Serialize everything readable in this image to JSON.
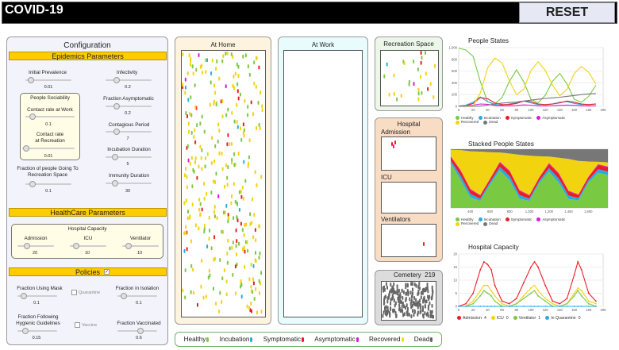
{
  "app": {
    "title": "COVID-19",
    "reset_label": "RESET"
  },
  "config": {
    "title": "Configuration",
    "epidemics": {
      "header": "Epidemics Parameters",
      "initial_prevalence": {
        "label": "Initial Prevalence",
        "value": "0.01",
        "fraction": 0.05
      },
      "infectivity": {
        "label": "Infectivity",
        "value": "0.2",
        "fraction": 0.2
      },
      "sociability_title": "People Sociability",
      "contact_work": {
        "label": "Contact rate at Work",
        "value": "0.1",
        "fraction": 0.1
      },
      "contact_recreation": {
        "label": "Contact rate\nat Recreation",
        "value": "0.01",
        "fraction": 0.02
      },
      "fraction_asymptomatic": {
        "label": "Fraction Asymptomatic",
        "value": "0.2",
        "fraction": 0.2
      },
      "contagious_period": {
        "label": "Contagious Period",
        "value": "7",
        "fraction": 0.2
      },
      "incubation_duration": {
        "label": "Incubation Duration",
        "value": "5",
        "fraction": 0.15
      },
      "fraction_recreation": {
        "label": "Fraction of people Going To\nRecreation Space",
        "value": "0.1",
        "fraction": 0.1
      },
      "immunity_duration": {
        "label": "Immunity Duration",
        "value": "30",
        "fraction": 0.15
      }
    },
    "healthcare": {
      "header": "HealthCare Parameters",
      "capacity_title": "Hospital Capacity",
      "admission": {
        "label": "Admission",
        "value": "20",
        "fraction": 0.2
      },
      "icu": {
        "label": "ICU",
        "value": "10",
        "fraction": 0.1
      },
      "ventilator": {
        "label": "Ventilator",
        "value": "10",
        "fraction": 0.1
      }
    },
    "policies": {
      "header": "Policies",
      "header_checked": true,
      "using_mask": {
        "label": "Fraction Using Mask",
        "value": "0.1",
        "fraction": 0.1
      },
      "quarantine_label": "Quarantine",
      "isolation": {
        "label": "Fraction in Isolation",
        "value": "0.1",
        "fraction": 0.1
      },
      "hygienic": {
        "label": "Fraction Following\nHygienic Guidelines",
        "value": "0.15",
        "fraction": 0.15
      },
      "vaccine_label": "Vaccine",
      "vaccinated": {
        "label": "Fraction Vaccinated",
        "value": "0.6",
        "fraction": 0.6
      }
    }
  },
  "spaces": {
    "home": "At Home",
    "work": "At Work",
    "recreation": "Recreation Space",
    "hospital": "Hospital",
    "admission": "Admission",
    "icu": "ICU",
    "ventilators": "Ventilators",
    "cemetery": "Cemetery",
    "cemetery_count": "219"
  },
  "legend": [
    {
      "label": "Healthy",
      "color": "#7ac943"
    },
    {
      "label": "Incubation",
      "color": "#29abe2"
    },
    {
      "label": "Symptomatic",
      "color": "#ed1c24"
    },
    {
      "label": "Asymptomatic",
      "color": "#d81bd8"
    },
    {
      "label": "Recovered",
      "color": "#f7e017"
    },
    {
      "label": "Dead",
      "color": "#666666"
    }
  ],
  "colors": {
    "healthy": "#7ac943",
    "incubation": "#29abe2",
    "symptomatic": "#ed1c24",
    "asymptomatic": "#d81bd8",
    "recovered": "#f2d30f",
    "dead": "#777777",
    "header_yellow": "#ffcc00"
  },
  "chart_data": [
    {
      "type": "line",
      "title": "People States",
      "xlim": [
        0,
        200
      ],
      "ylim": [
        0,
        1000
      ],
      "x_ticks": [
        "0",
        "20",
        "40",
        "60",
        "80",
        "100",
        "120",
        "140",
        "160",
        "180",
        "200"
      ],
      "y_ticks": [
        "0",
        "200",
        "400",
        "600",
        "800",
        "1,000"
      ],
      "x": [
        0,
        10,
        20,
        30,
        40,
        50,
        60,
        70,
        80,
        90,
        100,
        110,
        120,
        130,
        140,
        150,
        160,
        170,
        180,
        190
      ],
      "series": [
        {
          "name": "Healthy",
          "color": "#7ac943",
          "values": [
            990,
            960,
            850,
            420,
            80,
            40,
            150,
            420,
            620,
            420,
            120,
            60,
            190,
            430,
            560,
            380,
            120,
            70,
            170,
            360
          ]
        },
        {
          "name": "Incubation",
          "color": "#29abe2",
          "values": [
            5,
            20,
            70,
            160,
            80,
            30,
            20,
            40,
            60,
            90,
            60,
            30,
            30,
            40,
            70,
            80,
            50,
            30,
            30,
            40
          ]
        },
        {
          "name": "Symptomatic",
          "color": "#ed1c24",
          "values": [
            3,
            10,
            50,
            150,
            130,
            60,
            30,
            30,
            50,
            90,
            80,
            40,
            30,
            40,
            60,
            90,
            70,
            40,
            30,
            40
          ]
        },
        {
          "name": "Asymptomatic",
          "color": "#d81bd8",
          "values": [
            2,
            6,
            20,
            40,
            35,
            15,
            8,
            10,
            15,
            25,
            20,
            10,
            8,
            12,
            18,
            22,
            18,
            10,
            8,
            10
          ]
        },
        {
          "name": "Recovered",
          "color": "#f2d30f",
          "values": [
            0,
            4,
            10,
            230,
            650,
            820,
            740,
            440,
            200,
            290,
            610,
            760,
            610,
            360,
            180,
            290,
            560,
            680,
            580,
            380
          ]
        },
        {
          "name": "Dead",
          "color": "#777777",
          "values": [
            0,
            0,
            0,
            5,
            20,
            40,
            55,
            65,
            75,
            90,
            105,
            120,
            135,
            145,
            155,
            170,
            185,
            200,
            212,
            219
          ]
        }
      ],
      "legend": [
        "Healthy",
        "Incubation",
        "Symptomatic",
        "Asymptomatic",
        "Recovered",
        "Dead"
      ]
    },
    {
      "type": "area",
      "title": "Stacked People States",
      "x_ticks": [
        "400",
        "600",
        "800",
        "1,000",
        "1,200",
        "1,400",
        "1,600"
      ],
      "xlim": [
        200,
        1800
      ],
      "ylim": [
        0,
        1000
      ],
      "x": [
        200,
        300,
        400,
        500,
        600,
        700,
        800,
        900,
        1000,
        1100,
        1200,
        1300,
        1400,
        1500,
        1600,
        1700,
        1800
      ],
      "series": [
        {
          "name": "Healthy",
          "color": "#7ac943",
          "values": [
            760,
            480,
            180,
            120,
            400,
            640,
            470,
            160,
            120,
            420,
            620,
            430,
            150,
            130,
            430,
            600,
            560
          ]
        },
        {
          "name": "Incubation",
          "color": "#29abe2",
          "values": [
            50,
            70,
            60,
            40,
            40,
            60,
            70,
            60,
            40,
            40,
            60,
            70,
            60,
            40,
            40,
            60,
            60
          ]
        },
        {
          "name": "Symptomatic",
          "color": "#ed1c24",
          "values": [
            60,
            80,
            70,
            50,
            50,
            70,
            80,
            70,
            50,
            50,
            70,
            80,
            70,
            50,
            50,
            70,
            70
          ]
        },
        {
          "name": "Asymptomatic",
          "color": "#d81bd8",
          "values": [
            10,
            15,
            15,
            10,
            10,
            15,
            15,
            15,
            10,
            10,
            15,
            15,
            15,
            10,
            10,
            15,
            15
          ]
        },
        {
          "name": "Recovered",
          "color": "#f2d30f",
          "values": [
            110,
            340,
            640,
            740,
            450,
            160,
            290,
            600,
            670,
            360,
            110,
            260,
            540,
            570,
            260,
            40,
            70
          ]
        },
        {
          "name": "Dead",
          "color": "#777777",
          "values": [
            10,
            15,
            35,
            40,
            50,
            55,
            75,
            95,
            110,
            120,
            125,
            145,
            165,
            200,
            210,
            215,
            225
          ]
        }
      ],
      "legend": [
        "Healthy",
        "Incubation",
        "Symptomatic",
        "Asymptomatic",
        "Recovered",
        "Dead"
      ]
    },
    {
      "type": "line",
      "title": "Hospital Capacity",
      "xlim": [
        0,
        200
      ],
      "ylim": [
        0,
        20
      ],
      "x_ticks": [
        "0",
        "20",
        "40",
        "60",
        "80",
        "100",
        "120",
        "140",
        "160",
        "180",
        "200"
      ],
      "y_ticks": [
        "0",
        "5",
        "10",
        "15",
        "20"
      ],
      "x": [
        0,
        10,
        20,
        30,
        35,
        40,
        45,
        50,
        60,
        70,
        80,
        90,
        100,
        105,
        110,
        120,
        130,
        140,
        150,
        160,
        165,
        170,
        180,
        190
      ],
      "series": [
        {
          "name": "Admission",
          "color": "#ed1c24",
          "values": [
            0,
            1,
            5,
            14,
            17,
            16,
            14,
            8,
            2,
            1,
            3,
            9,
            15,
            17,
            15,
            8,
            2,
            1,
            3,
            12,
            17,
            14,
            5,
            2
          ]
        },
        {
          "name": "ICU",
          "color": "#f2d30f",
          "values": [
            0,
            0,
            2,
            6,
            8,
            8,
            6,
            4,
            1,
            0,
            1,
            4,
            7,
            8,
            6,
            3,
            1,
            0,
            1,
            5,
            7,
            6,
            2,
            1
          ]
        },
        {
          "name": "Ventilator",
          "color": "#7ac943",
          "values": [
            0,
            0,
            1,
            4,
            6,
            5,
            4,
            2,
            0,
            0,
            1,
            3,
            5,
            6,
            4,
            2,
            0,
            0,
            1,
            4,
            6,
            4,
            1,
            0
          ]
        },
        {
          "name": "In Quarantine",
          "color": "#29abe2",
          "values": [
            0,
            0,
            0,
            0,
            0,
            0,
            0,
            0,
            0,
            0,
            0,
            0,
            0,
            0,
            0,
            0,
            0,
            0,
            0,
            0,
            0,
            0,
            0,
            0
          ]
        }
      ],
      "legend": [
        {
          "label": "Admission",
          "value": "4"
        },
        {
          "label": "ICU",
          "value": "0"
        },
        {
          "label": "Ventilator",
          "value": "1"
        },
        {
          "label": "In Quarantine",
          "value": "0"
        }
      ]
    }
  ]
}
